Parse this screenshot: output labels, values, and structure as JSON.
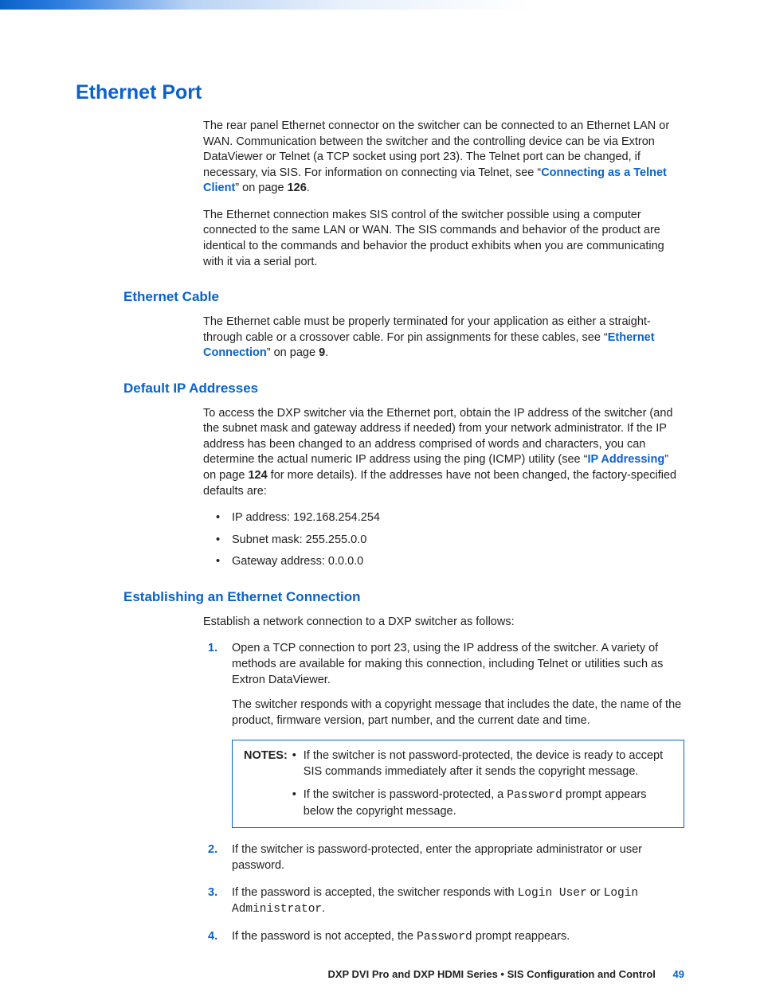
{
  "title": "Ethernet Port",
  "intro": {
    "p1_a": "The rear panel Ethernet connector on the switcher can be connected to an Ethernet LAN or WAN. Communication between the switcher and the controlling device can be via Extron DataViewer or Telnet (a TCP socket using port 23). The Telnet port can be changed, if necessary, via SIS. For information on connecting via Telnet, see “",
    "link1": "Connecting as a Telnet Client",
    "p1_b": "” on page ",
    "page1": "126",
    "p1_c": ".",
    "p2": "The Ethernet connection makes SIS control of the switcher possible using a computer connected to the same LAN or WAN. The SIS commands and behavior of the product are identical to the commands and behavior the product exhibits when you are communicating with it via a serial port."
  },
  "cable": {
    "heading": "Ethernet Cable",
    "p1_a": "The Ethernet cable must be properly terminated for your application as either a straight-through cable or a crossover cable. For pin assignments for these cables, see “",
    "link": "Ethernet Connection",
    "p1_b": "” on page ",
    "page": "9",
    "p1_c": "."
  },
  "ip": {
    "heading": "Default IP Addresses",
    "p1_a": "To access the DXP switcher via the Ethernet port, obtain the IP address of the switcher (and the subnet mask and gateway address if needed) from your network administrator. If the IP address has been changed to an address comprised of words and characters, you can determine the actual numeric IP address using the ping (ICMP) utility (see “",
    "link": "IP Addressing",
    "p1_b": "” on page ",
    "page": "124",
    "p1_c": " for more details). If the addresses have not been changed, the factory-specified defaults are:",
    "bullets": [
      "IP address:  192.168.254.254",
      "Subnet mask:  255.255.0.0",
      "Gateway address:  0.0.0.0"
    ]
  },
  "establish": {
    "heading": "Establishing an Ethernet Connection",
    "intro": "Establish a network connection to a DXP switcher as follows:",
    "steps": {
      "s1": {
        "num": "1.",
        "text": "Open a TCP connection to port 23, using the IP address of the switcher. A variety of methods are available for making this connection, including Telnet or utilities such as Extron DataViewer.",
        "extra": "The switcher responds with a copyright message that includes the date, the name of the product, firmware version, part number, and the current date and time."
      },
      "s2": {
        "num": "2.",
        "text": "If the switcher is password-protected, enter the appropriate administrator or user password."
      },
      "s3": {
        "num": "3.",
        "a": "If the password is accepted, the switcher responds with ",
        "m1": "Login User",
        "b": " or ",
        "m2": "Login Administrator",
        "c": "."
      },
      "s4": {
        "num": "4.",
        "a": "If the password is not accepted, the ",
        "m": "Password",
        "b": " prompt reappears."
      }
    },
    "notes": {
      "label": "NOTES:",
      "n1": "If the switcher is not password-protected, the device is ready to accept SIS commands immediately after it sends the copyright message.",
      "n2_a": "If the switcher is password-protected, a ",
      "n2_m": "Password",
      "n2_b": " prompt appears below the copyright message."
    }
  },
  "footer": {
    "doc": "DXP DVI Pro and DXP HDMI Series • SIS Configuration and Control",
    "page": "49"
  }
}
